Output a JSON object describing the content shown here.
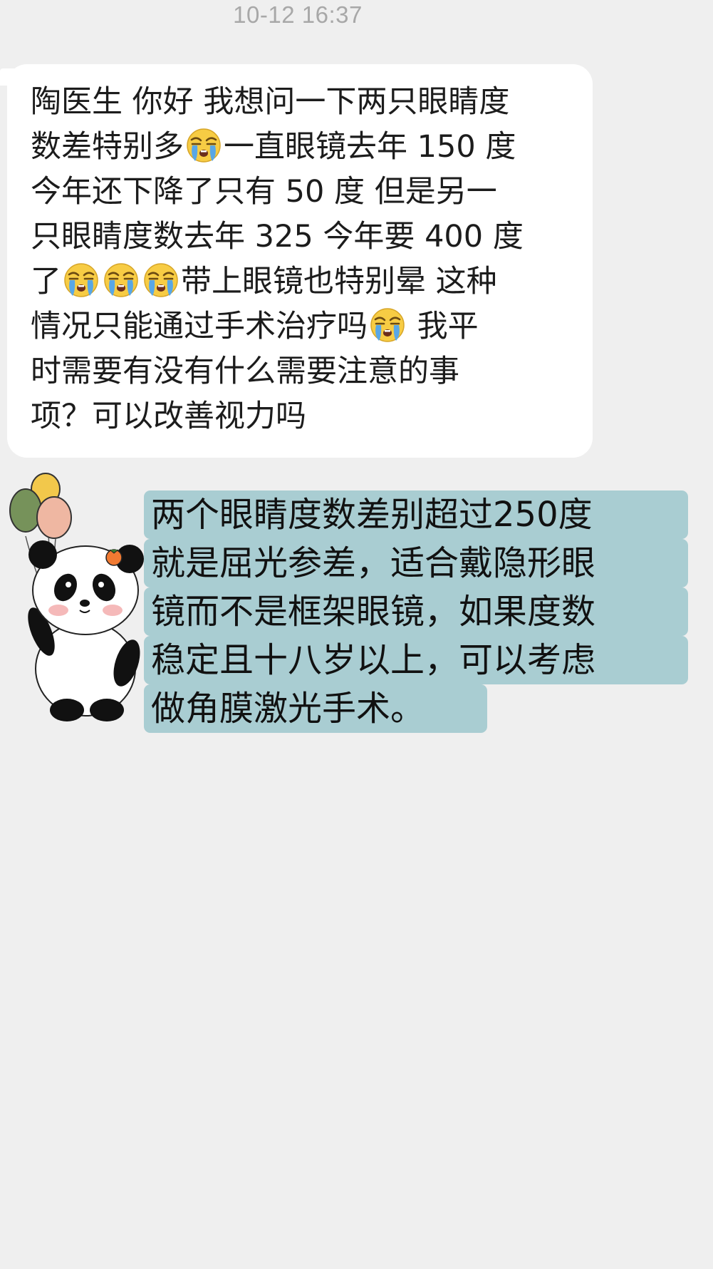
{
  "timestamp": "10-12 16:37",
  "incoming_message": {
    "segments": {
      "l1": "陶医生 你好 我想问一下两只眼睛度",
      "l2a": "数差特别多",
      "l2b": "一直眼镜去年 150 度",
      "l3": "今年还下降了只有 50 度 但是另一",
      "l4": "只眼睛度数去年 325 今年要 400 度",
      "l5a": "了",
      "l5b": "带上眼镜也特别晕 这种",
      "l6a": "情况只能通过手术治疗吗",
      "l6b": " 我平",
      "l7": "时需要有没有什么需要注意的事",
      "l8": "项？可以改善视力吗"
    },
    "emoji_name": "loudly-crying-face-icon"
  },
  "reply": {
    "sticker": "panda-with-balloons",
    "lines": [
      "两个眼睛度数差别超过250度",
      "就是屈光参差，适合戴隐形眼",
      "镜而不是框架眼镜，如果度数",
      "稳定且十八岁以上，可以考虑",
      "做角膜激光手术。"
    ],
    "highlight_color": "#a9cdd2"
  }
}
